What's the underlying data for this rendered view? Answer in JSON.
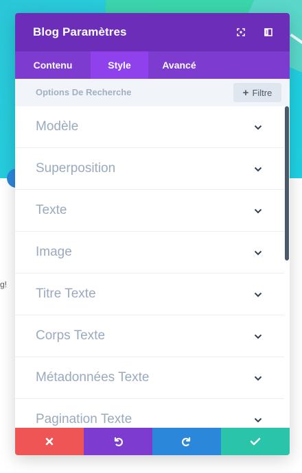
{
  "background": {
    "hero_color": "#22cfe0",
    "text_fragment": "g!"
  },
  "modal": {
    "title": "Blog Paramètres",
    "header_icons": [
      "fullscreen-icon",
      "sidebar-toggle-icon"
    ],
    "tabs": [
      {
        "label": "Contenu",
        "active": false
      },
      {
        "label": "Style",
        "active": true
      },
      {
        "label": "Avancé",
        "active": false
      }
    ],
    "search": {
      "label": "Options De Recherche",
      "filter_label": "Filtre"
    },
    "groups": [
      {
        "label": "Modèle"
      },
      {
        "label": "Superposition"
      },
      {
        "label": "Texte"
      },
      {
        "label": "Image"
      },
      {
        "label": "Titre Texte"
      },
      {
        "label": "Corps Texte"
      },
      {
        "label": "Métadonnées Texte"
      },
      {
        "label": "Pagination Texte"
      }
    ],
    "footer": [
      {
        "action": "cancel",
        "icon": "close-icon",
        "color": "#ef5555"
      },
      {
        "action": "undo",
        "icon": "undo-icon",
        "color": "#7e3bd0"
      },
      {
        "action": "redo",
        "icon": "redo-icon",
        "color": "#2b87da"
      },
      {
        "action": "save",
        "icon": "check-icon",
        "color": "#29c4a9"
      }
    ]
  },
  "colors": {
    "header": "#6c2eb9",
    "tabs_bar": "#7e3bd0",
    "active_tab": "#8f42ec",
    "group_label": "#9aaabd"
  }
}
